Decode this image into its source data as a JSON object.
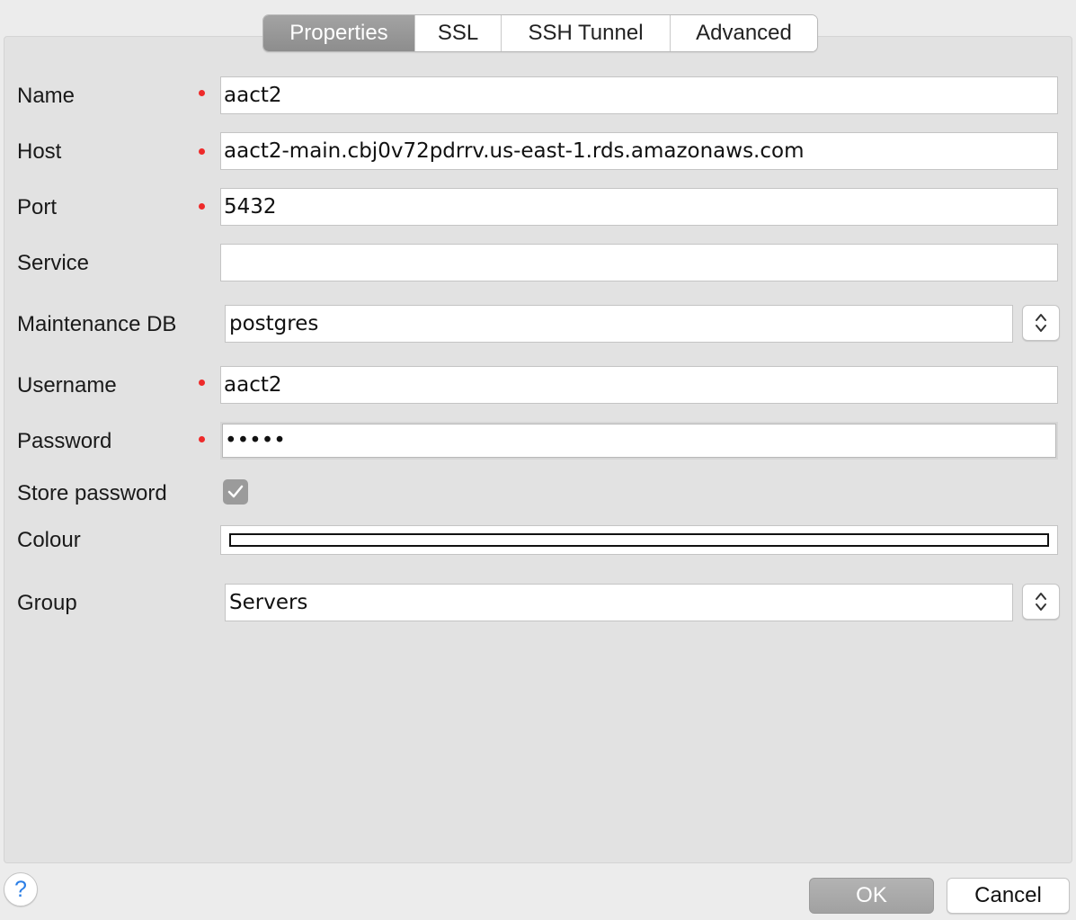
{
  "tabs": [
    {
      "label": "Properties",
      "active": true
    },
    {
      "label": "SSL",
      "active": false
    },
    {
      "label": "SSH Tunnel",
      "active": false
    },
    {
      "label": "Advanced",
      "active": false
    }
  ],
  "form": {
    "name": {
      "label": "Name",
      "value": "aact2",
      "required": true
    },
    "host": {
      "label": "Host",
      "value": "aact2-main.cbj0v72pdrrv.us-east-1.rds.amazonaws.com",
      "required": true
    },
    "port": {
      "label": "Port",
      "value": "5432",
      "required": true
    },
    "service": {
      "label": "Service",
      "value": "",
      "required": false
    },
    "maintenance_db": {
      "label": "Maintenance DB",
      "value": "postgres"
    },
    "username": {
      "label": "Username",
      "value": "aact2",
      "required": true
    },
    "password": {
      "label": "Password",
      "value": "•••••",
      "required": true
    },
    "store_password": {
      "label": "Store password",
      "checked": true
    },
    "colour": {
      "label": "Colour",
      "value": "#ffffff"
    },
    "group": {
      "label": "Group",
      "value": "Servers"
    }
  },
  "footer": {
    "help_label": "?",
    "ok_label": "OK",
    "cancel_label": "Cancel"
  },
  "colors": {
    "required_marker": "#ee2a2a",
    "active_tab": "#999999",
    "help_icon": "#2a7ee6"
  },
  "icons": {
    "stepper": "chevron-up-down-icon",
    "checkbox": "checkmark-icon",
    "help": "question-mark-icon"
  }
}
